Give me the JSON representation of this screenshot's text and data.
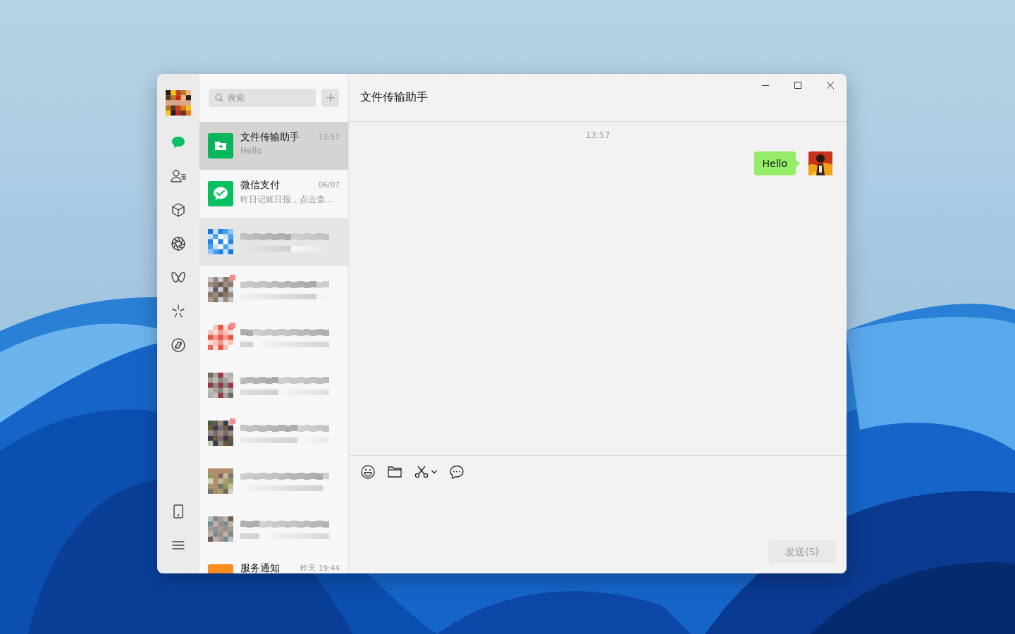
{
  "sidebar": {
    "items": [
      {
        "kind": "chats",
        "selected": true
      },
      {
        "kind": "contacts",
        "selected": false
      },
      {
        "kind": "favorites",
        "selected": false
      },
      {
        "kind": "moments",
        "selected": false
      },
      {
        "kind": "channels",
        "selected": false
      },
      {
        "kind": "discover",
        "selected": false
      },
      {
        "kind": "miniprograms",
        "selected": false
      }
    ],
    "bottom_items": [
      {
        "kind": "phone"
      },
      {
        "kind": "menu"
      }
    ]
  },
  "search": {
    "placeholder": "搜索"
  },
  "chats": [
    {
      "kind": "transfer",
      "name": "文件传输助手",
      "time": "13:57",
      "preview": "Hello",
      "selected": true
    },
    {
      "kind": "payment",
      "name": "微信支付",
      "time": "06/07",
      "preview": "昨日记账日报，点击查...",
      "selected": false
    },
    {
      "kind": "blurred",
      "selected": false,
      "hovered": true,
      "unread": false
    },
    {
      "kind": "blurred",
      "selected": false,
      "hovered": false,
      "unread": true
    },
    {
      "kind": "blurred",
      "selected": false,
      "hovered": false,
      "unread": true
    },
    {
      "kind": "blurred",
      "selected": false,
      "hovered": false,
      "unread": false
    },
    {
      "kind": "blurred",
      "selected": false,
      "hovered": false,
      "unread": true
    },
    {
      "kind": "blurred",
      "selected": false,
      "hovered": false,
      "unread": false
    },
    {
      "kind": "blurred",
      "selected": false,
      "hovered": false,
      "unread": false
    },
    {
      "kind": "notice",
      "name": "服务通知",
      "time": "昨天 19:44",
      "selected": false
    }
  ],
  "chat": {
    "title": "文件传输助手",
    "messages": [
      {
        "kind": "time",
        "text": "13:57"
      },
      {
        "kind": "bubble",
        "outgoing": true,
        "text": "Hello"
      }
    ],
    "send_button": {
      "label": "发送(S)",
      "disabled": true
    }
  }
}
